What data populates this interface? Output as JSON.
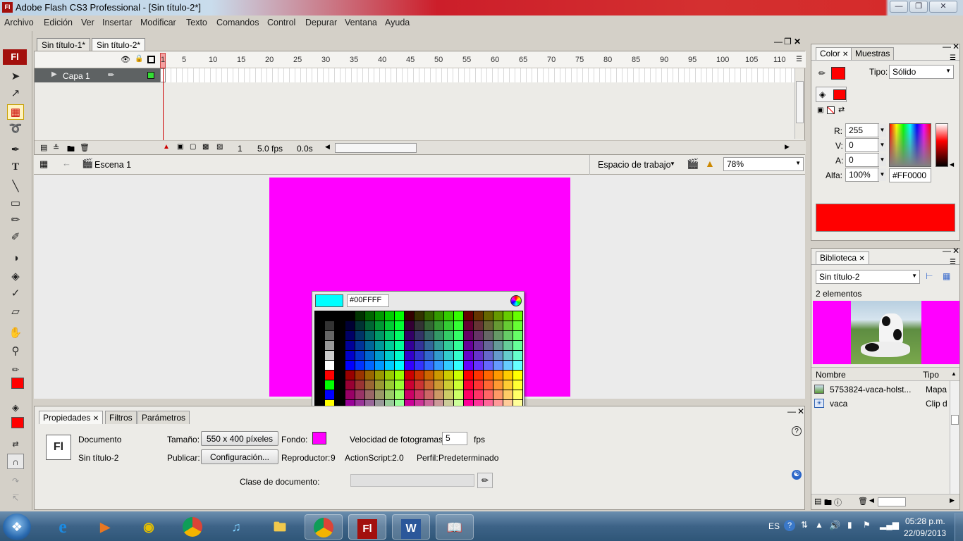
{
  "window": {
    "title": "Adobe Flash CS3 Professional - [Sin título-2*]",
    "app_icon": "Fl",
    "controls": [
      "minimize-icon",
      "maximize-icon",
      "close-icon"
    ]
  },
  "menu": [
    "Archivo",
    "Edición",
    "Ver",
    "Insertar",
    "Modificar",
    "Texto",
    "Comandos",
    "Control",
    "Depurar",
    "Ventana",
    "Ayuda"
  ],
  "doc_tabs": [
    "Sin título-1*",
    "Sin título-2*"
  ],
  "timeline": {
    "frame_numbers": [
      "1",
      "5",
      "10",
      "15",
      "20",
      "25",
      "30",
      "35",
      "40",
      "45",
      "50",
      "55",
      "60",
      "65",
      "70",
      "75",
      "80",
      "85",
      "90",
      "95",
      "100",
      "105",
      "110"
    ],
    "layer_name": "Capa 1",
    "current_frame": "1",
    "fps": "5.0 fps",
    "time": "0.0s"
  },
  "scene": {
    "name": "Escena 1",
    "workspace": "Espacio de trabajo",
    "zoom": "78%"
  },
  "stage": {
    "background": "#ff00ff"
  },
  "color_picker": {
    "hex_value": "#00FFFF",
    "preview_color": "#00ffff"
  },
  "properties": {
    "tabs": [
      "Propiedades",
      "Filtros",
      "Parámetros"
    ],
    "icon": "Fl",
    "doc_type": "Documento",
    "doc_name": "Sin título-2",
    "size_label": "Tamaño:",
    "size_value": "550 x 400 píxeles",
    "publish_label": "Publicar:",
    "publish_button": "Configuración...",
    "bg_label": "Fondo:",
    "bg_color": "#ff00ff",
    "player_label": "Reproductor:",
    "player_value": "9",
    "as_label": "ActionScript:",
    "as_value": "2.0",
    "profile_label": "Perfil:",
    "profile_value": "Predeterminado",
    "fps_label": "Velocidad de fotogramas:",
    "fps_value": "5",
    "fps_unit": "fps",
    "class_label": "Clase de documento:",
    "class_value": ""
  },
  "color_panel": {
    "tabs": [
      "Color",
      "Muestras"
    ],
    "type_label": "Tipo:",
    "type_value": "Sólido",
    "r_label": "R:",
    "r_value": "255",
    "g_label": "V:",
    "g_value": "0",
    "b_label": "A:",
    "b_value": "0",
    "alpha_label": "Alfa:",
    "alpha_value": "100%",
    "hex_value": "#FF0000",
    "stroke_color": "#ff0000",
    "fill_color": "#ff0000",
    "preview_color": "#ff0000"
  },
  "library": {
    "tab": "Biblioteca",
    "doc_select": "Sin título-2",
    "count": "2 elementos",
    "col_name": "Nombre",
    "col_type": "Tipo",
    "items": [
      {
        "name": "5753824-vaca-holst...",
        "type": "Mapa",
        "icon": "bitmap-icon"
      },
      {
        "name": "vaca",
        "type": "Clip d",
        "icon": "movieclip-icon"
      }
    ]
  },
  "taskbar": {
    "lang": "ES",
    "time": "05:28 p.m.",
    "date": "22/09/2013",
    "apps": [
      "internet-explorer-icon",
      "media-player-icon",
      "media-center-icon",
      "chrome-icon",
      "itunes-icon",
      "file-explorer-icon",
      "chrome-icon",
      "flash-icon",
      "word-icon",
      "ebook-icon"
    ],
    "flash_label": "Fl",
    "word_label": "W"
  }
}
